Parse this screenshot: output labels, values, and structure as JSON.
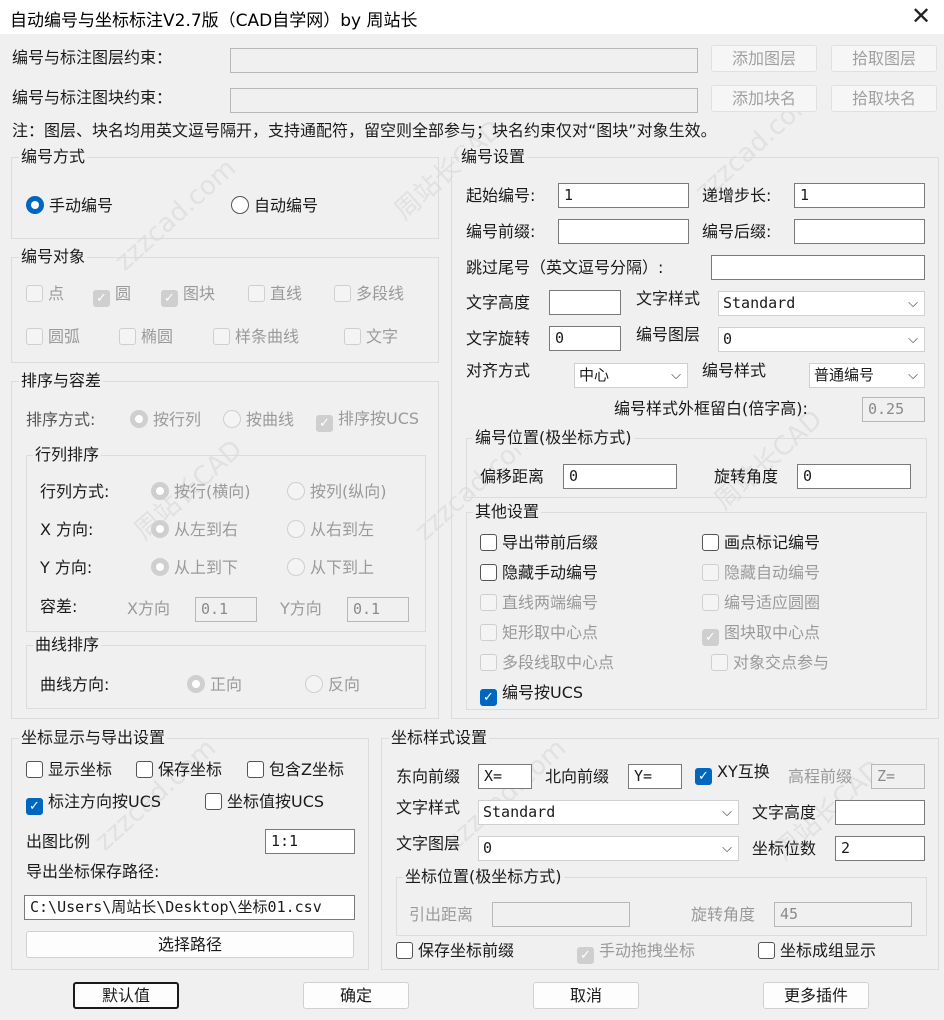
{
  "window": {
    "title": "自动编号与坐标标注V2.7版（CAD自学网）by 周站长",
    "close_glyph": "✕"
  },
  "constraints": {
    "layer_label": "编号与标注图层约束：",
    "layer_value": "",
    "block_label": "编号与标注图块约束：",
    "block_value": "",
    "add_layer": "添加图层",
    "pick_layer": "拾取图层",
    "add_block": "添加块名",
    "pick_block": "拾取块名",
    "note": "注：图层、块名均用英文逗号隔开，支持通配符，留空则全部参与；块名约束仅对“图块”对象生效。"
  },
  "numbering_mode": {
    "title": "编号方式",
    "manual": "手动编号",
    "auto": "自动编号",
    "selected": "manual"
  },
  "numbering_objects": {
    "title": "编号对象",
    "items": [
      {
        "label": "点",
        "checked": false
      },
      {
        "label": "圆",
        "checked": true
      },
      {
        "label": "图块",
        "checked": true
      },
      {
        "label": "直线",
        "checked": false
      },
      {
        "label": "多段线",
        "checked": false
      },
      {
        "label": "圆弧",
        "checked": false
      },
      {
        "label": "椭圆",
        "checked": false
      },
      {
        "label": "样条曲线",
        "checked": false
      },
      {
        "label": "文字",
        "checked": false
      }
    ]
  },
  "sorting": {
    "title": "排序与容差",
    "sort_label": "排序方式:",
    "by_row_col": "按行列",
    "by_curve": "按曲线",
    "ucs": "排序按UCS",
    "row_col_title": "行列排序",
    "row_col_mode_label": "行列方式:",
    "by_row": "按行(横向)",
    "by_col": "按列(纵向)",
    "x_label": "X 方向:",
    "x_lr": "从左到右",
    "x_rl": "从右到左",
    "y_label": "Y 方向:",
    "y_tb": "从上到下",
    "y_bt": "从下到上",
    "tol_label": "容差:",
    "tol_x_label": "X方向",
    "tol_x": "0.1",
    "tol_y_label": "Y方向",
    "tol_y": "0.1",
    "curve_title": "曲线排序",
    "curve_dir_label": "曲线方向:",
    "forward": "正向",
    "reverse": "反向"
  },
  "numbering_settings": {
    "title": "编号设置",
    "start_label": "起始编号:",
    "start": "1",
    "step_label": "递增步长:",
    "step": "1",
    "prefix_label": "编号前缀:",
    "prefix": "",
    "suffix_label": "编号后缀:",
    "suffix": "",
    "skip_label": "跳过尾号（英文逗号分隔）:",
    "skip": "",
    "text_height_label": "文字高度",
    "text_height": "",
    "text_style_label": "文字样式",
    "text_style": "Standard",
    "text_rot_label": "文字旋转",
    "text_rot": "0",
    "layer_label": "编号图层",
    "layer": "0",
    "align_label": "对齐方式",
    "align": "中心",
    "num_style_label": "编号样式",
    "num_style": "普通编号",
    "frame_margin_label": "编号样式外框留白(倍字高):",
    "frame_margin": "0.25",
    "polar_title": "编号位置(极坐标方式)",
    "offset_label": "偏移距离",
    "offset": "0",
    "rotate_label": "旋转角度",
    "rotate": "0",
    "other_title": "其他设置",
    "other_items": [
      {
        "label": "导出带前后缀",
        "checked": false,
        "disabled": false
      },
      {
        "label": "画点标记编号",
        "checked": false,
        "disabled": false
      },
      {
        "label": "隐藏手动编号",
        "checked": false,
        "disabled": false
      },
      {
        "label": "隐藏自动编号",
        "checked": false,
        "disabled": true
      },
      {
        "label": "直线两端编号",
        "checked": false,
        "disabled": true
      },
      {
        "label": "编号适应圆圈",
        "checked": false,
        "disabled": true
      },
      {
        "label": "矩形取中心点",
        "checked": false,
        "disabled": true
      },
      {
        "label": "图块取中心点",
        "checked": true,
        "disabled": true
      },
      {
        "label": "多段线取中心点",
        "checked": false,
        "disabled": true
      },
      {
        "label": "对象交点参与",
        "checked": false,
        "disabled": true
      },
      {
        "label": "编号按UCS",
        "checked": true,
        "disabled": false
      }
    ]
  },
  "coord_display": {
    "title": "坐标显示与导出设置",
    "show": "显示坐标",
    "save": "保存坐标",
    "include_z": "包含Z坐标",
    "label_ucs": "标注方向按UCS",
    "value_ucs": "坐标值按UCS",
    "label_ucs_checked": true,
    "scale_label": "出图比例",
    "scale": "1:1",
    "path_label": "导出坐标保存路径:",
    "path": "C:\\Users\\周站长\\Desktop\\坐标01.csv",
    "choose_path": "选择路径"
  },
  "coord_style": {
    "title": "坐标样式设置",
    "east_label": "东向前缀",
    "east": "X=",
    "north_label": "北向前缀",
    "north": "Y=",
    "xy_swap": "XY互换",
    "xy_swap_checked": true,
    "elev_label": "高程前缀",
    "elev": "Z=",
    "text_style_label": "文字样式",
    "text_style": "Standard",
    "text_height_label": "文字高度",
    "text_height": "",
    "layer_label": "文字图层",
    "layer": "0",
    "digits_label": "坐标位数",
    "digits": "2",
    "polar_title": "坐标位置(极坐标方式)",
    "lead_label": "引出距离",
    "lead": "",
    "rot_label": "旋转角度",
    "rot": "45",
    "save_prefix": "保存坐标前缀",
    "manual_drag": "手动拖拽坐标",
    "group_display": "坐标成组显示"
  },
  "footer": {
    "default": "默认值",
    "ok": "确定",
    "cancel": "取消",
    "more": "更多插件"
  },
  "watermarks": [
    "周站长CAD",
    "zzzcad.com"
  ]
}
